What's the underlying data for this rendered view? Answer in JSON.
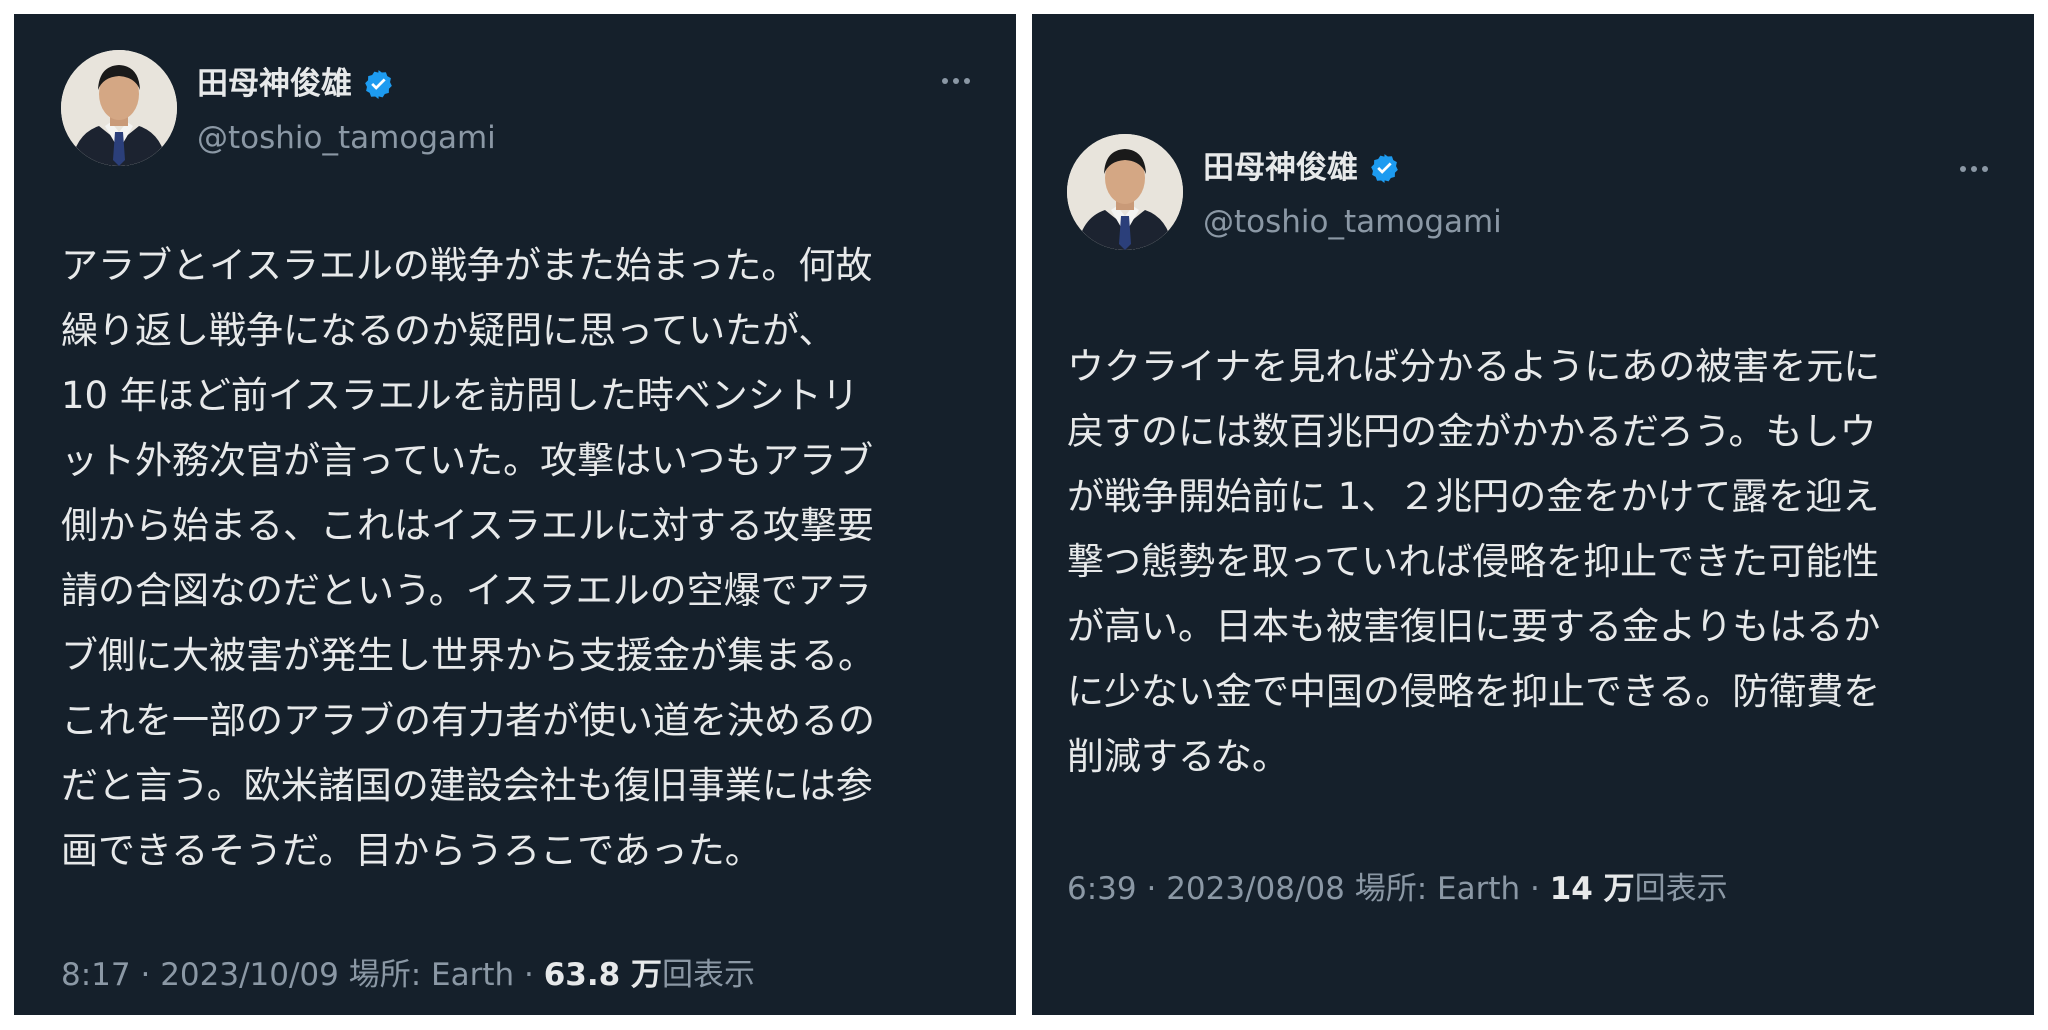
{
  "colors": {
    "card_bg": "#15202b",
    "text_primary": "#e7e9ea",
    "text_secondary": "#8b98a5",
    "verified_blue": "#1d9bf0"
  },
  "tweets": [
    {
      "author": {
        "name": "田母神俊雄",
        "handle": "@toshio_tamogami",
        "verified_icon": "verified-badge-icon"
      },
      "more_icon": "more-options-icon",
      "lines": [
        "アラブとイスラエルの戦争がまた始まった。何故",
        "繰り返し戦争になるのか疑問に思っていたが、",
        "10 年ほど前イスラエルを訪問した時ベンシトリ",
        "ット外務次官が言っていた。攻撃はいつもアラブ",
        "側から始まる、これはイスラエルに対する攻撃要",
        "請の合図なのだという。イスラエルの空爆でアラ",
        "ブ側に大被害が発生し世界から支援金が集まる。",
        "これを一部のアラブの有力者が使い道を決めるの",
        "だと言う。欧米諸国の建設会社も復旧事業には参",
        "画できるそうだ。目からうろこであった。"
      ],
      "meta": {
        "time": "8:17",
        "date": "2023/10/09",
        "location": "場所: Earth",
        "views_count": "63.8 万",
        "views_label": "回表示"
      }
    },
    {
      "author": {
        "name": "田母神俊雄",
        "handle": "@toshio_tamogami",
        "verified_icon": "verified-badge-icon"
      },
      "more_icon": "more-options-icon",
      "lines": [
        "ウクライナを見れば分かるようにあの被害を元に",
        "戻すのには数百兆円の金がかかるだろう。もしウ",
        "が戦争開始前に 1、２兆円の金をかけて露を迎え",
        "撃つ態勢を取っていれば侵略を抑止できた可能性",
        "が高い。日本も被害復旧に要する金よりもはるか",
        "に少ない金で中国の侵略を抑止できる。防衛費を",
        "削減するな。"
      ],
      "meta": {
        "time": "6:39",
        "date": "2023/08/08",
        "location": "場所: Earth",
        "views_count": "14 万",
        "views_label": "回表示"
      }
    }
  ]
}
